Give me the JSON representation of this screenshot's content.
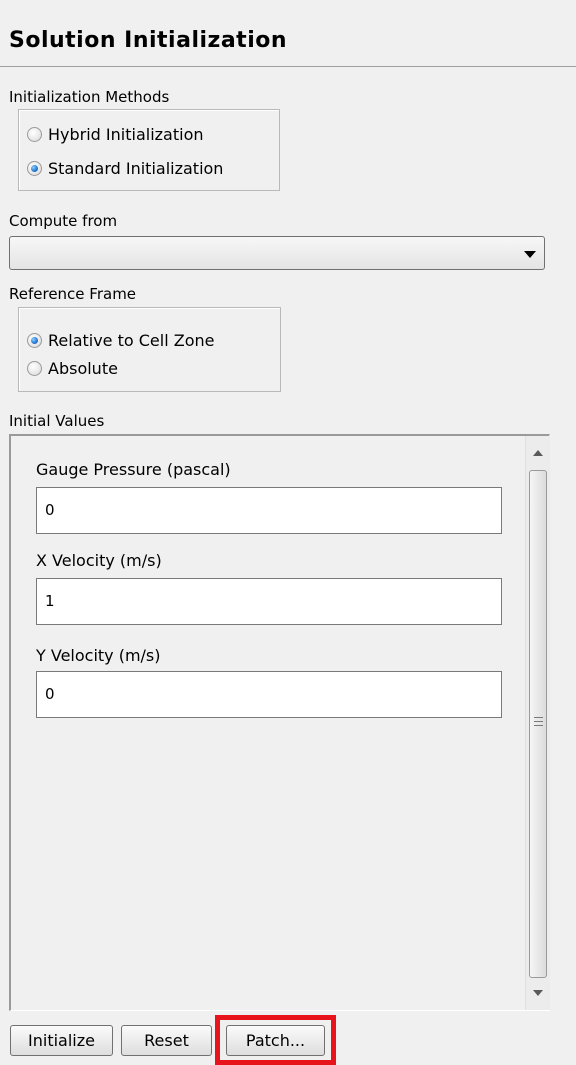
{
  "panel": {
    "title": "Solution Initialization"
  },
  "init_methods": {
    "label": "Initialization Methods",
    "options": [
      {
        "label": "Hybrid  Initialization",
        "checked": false
      },
      {
        "label": "Standard Initialization",
        "checked": true
      }
    ]
  },
  "compute_from": {
    "label": "Compute from",
    "value": ""
  },
  "reference_frame": {
    "label": "Reference Frame",
    "options": [
      {
        "label": "Relative to Cell Zone",
        "checked": true
      },
      {
        "label": "Absolute",
        "checked": false
      }
    ]
  },
  "initial_values": {
    "label": "Initial Values",
    "fields": [
      {
        "label": "Gauge Pressure (pascal)",
        "value": "0"
      },
      {
        "label": "X Velocity (m/s)",
        "value": "1"
      },
      {
        "label": "Y Velocity (m/s)",
        "value": "0"
      }
    ]
  },
  "buttons": {
    "initialize": "Initialize",
    "reset": "Reset",
    "patch": "Patch..."
  },
  "colors": {
    "highlight": "#e8141b",
    "radio_selected": "#2a7bd3"
  }
}
